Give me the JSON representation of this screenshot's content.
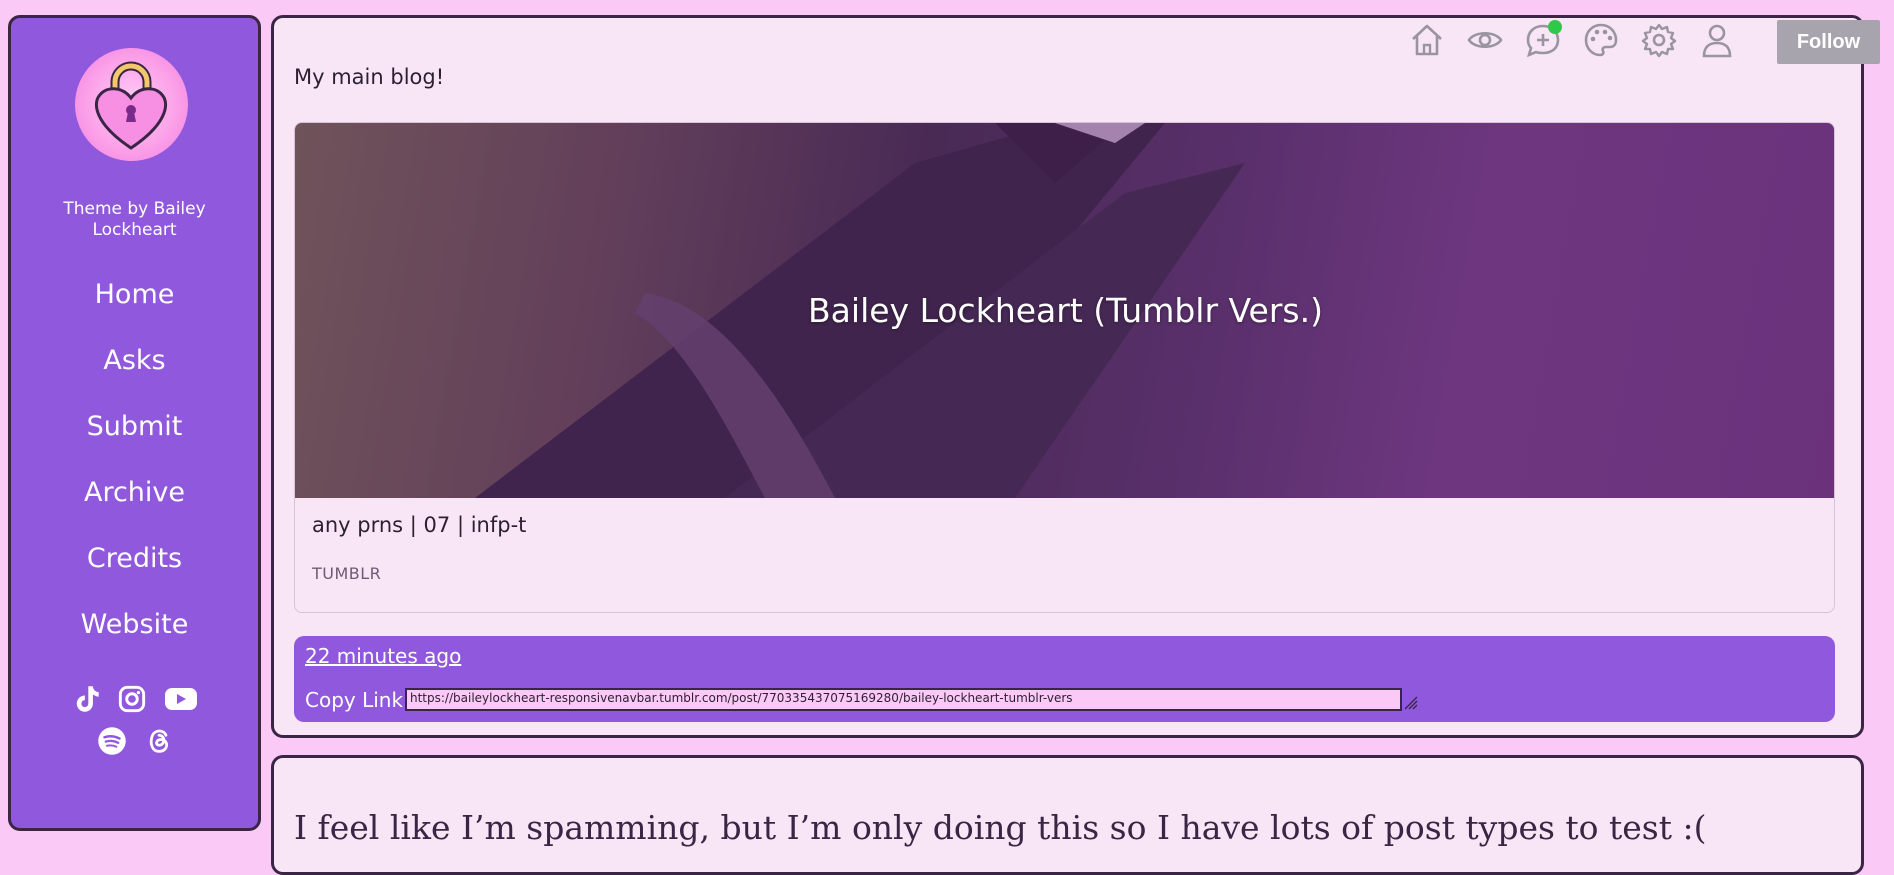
{
  "sidebar": {
    "avatar_icon": "heart-padlock-icon",
    "theme_credit": "Theme by Bailey Lockheart",
    "nav": [
      {
        "label": "Home"
      },
      {
        "label": "Asks"
      },
      {
        "label": "Submit"
      },
      {
        "label": "Archive"
      },
      {
        "label": "Credits"
      },
      {
        "label": "Website"
      }
    ],
    "socials": [
      "tiktok-icon",
      "instagram-icon",
      "youtube-icon",
      "spotify-icon",
      "threads-icon"
    ]
  },
  "toolbar": {
    "icons": [
      "home-icon",
      "eye-icon",
      "chat-add-icon",
      "palette-icon",
      "gear-icon",
      "user-icon"
    ],
    "follow_label": "Follow",
    "notification_color": "#2ec84a"
  },
  "post": {
    "description": "My main blog!",
    "link": {
      "title": "Bailey Lockheart (Tumblr Vers.)",
      "excerpt": "any prns | 07 | infp-t",
      "host": "TUMBLR"
    },
    "timestamp": "22 minutes ago",
    "copy_label": "Copy Link:",
    "copy_value": "https://baileylockheart-responsivenavbar.tumblr.com/post/770335437075169280/bailey-lockheart-tumblr-vers"
  },
  "next_post": {
    "text": "I feel like I’m spamming, but I’m only doing this so I have lots of post types to test :("
  },
  "colors": {
    "background": "#fbc9f6",
    "sidebar": "#9058dc",
    "card": "#f8e6f6",
    "border": "#3b2545"
  }
}
